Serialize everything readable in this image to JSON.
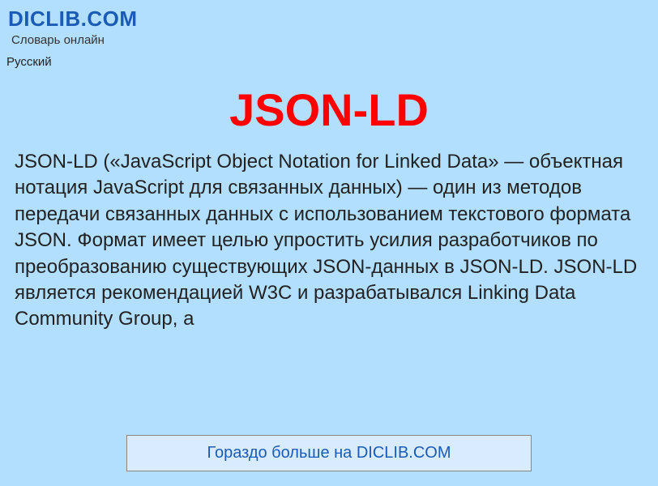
{
  "header": {
    "site_title": "DICLIB.COM",
    "site_subtitle": "Словарь онлайн"
  },
  "language": {
    "current": "Русский"
  },
  "article": {
    "title": "JSON-LD",
    "description": "JSON-LD («JavaScript Object Notation for Linked Data» — объектная нотация JavaScript для связанных данных) — один из методов передачи связанных данных с использованием текстового формата JSON. Формат имеет целью упростить усилия разработчиков по преобразованию существующих JSON-данных в JSON-LD. JSON-LD является рекомендацией W3C и разрабатывался Linking Data Community Group, а"
  },
  "footer": {
    "link_text": "Гораздо больше на DICLIB.COM"
  }
}
